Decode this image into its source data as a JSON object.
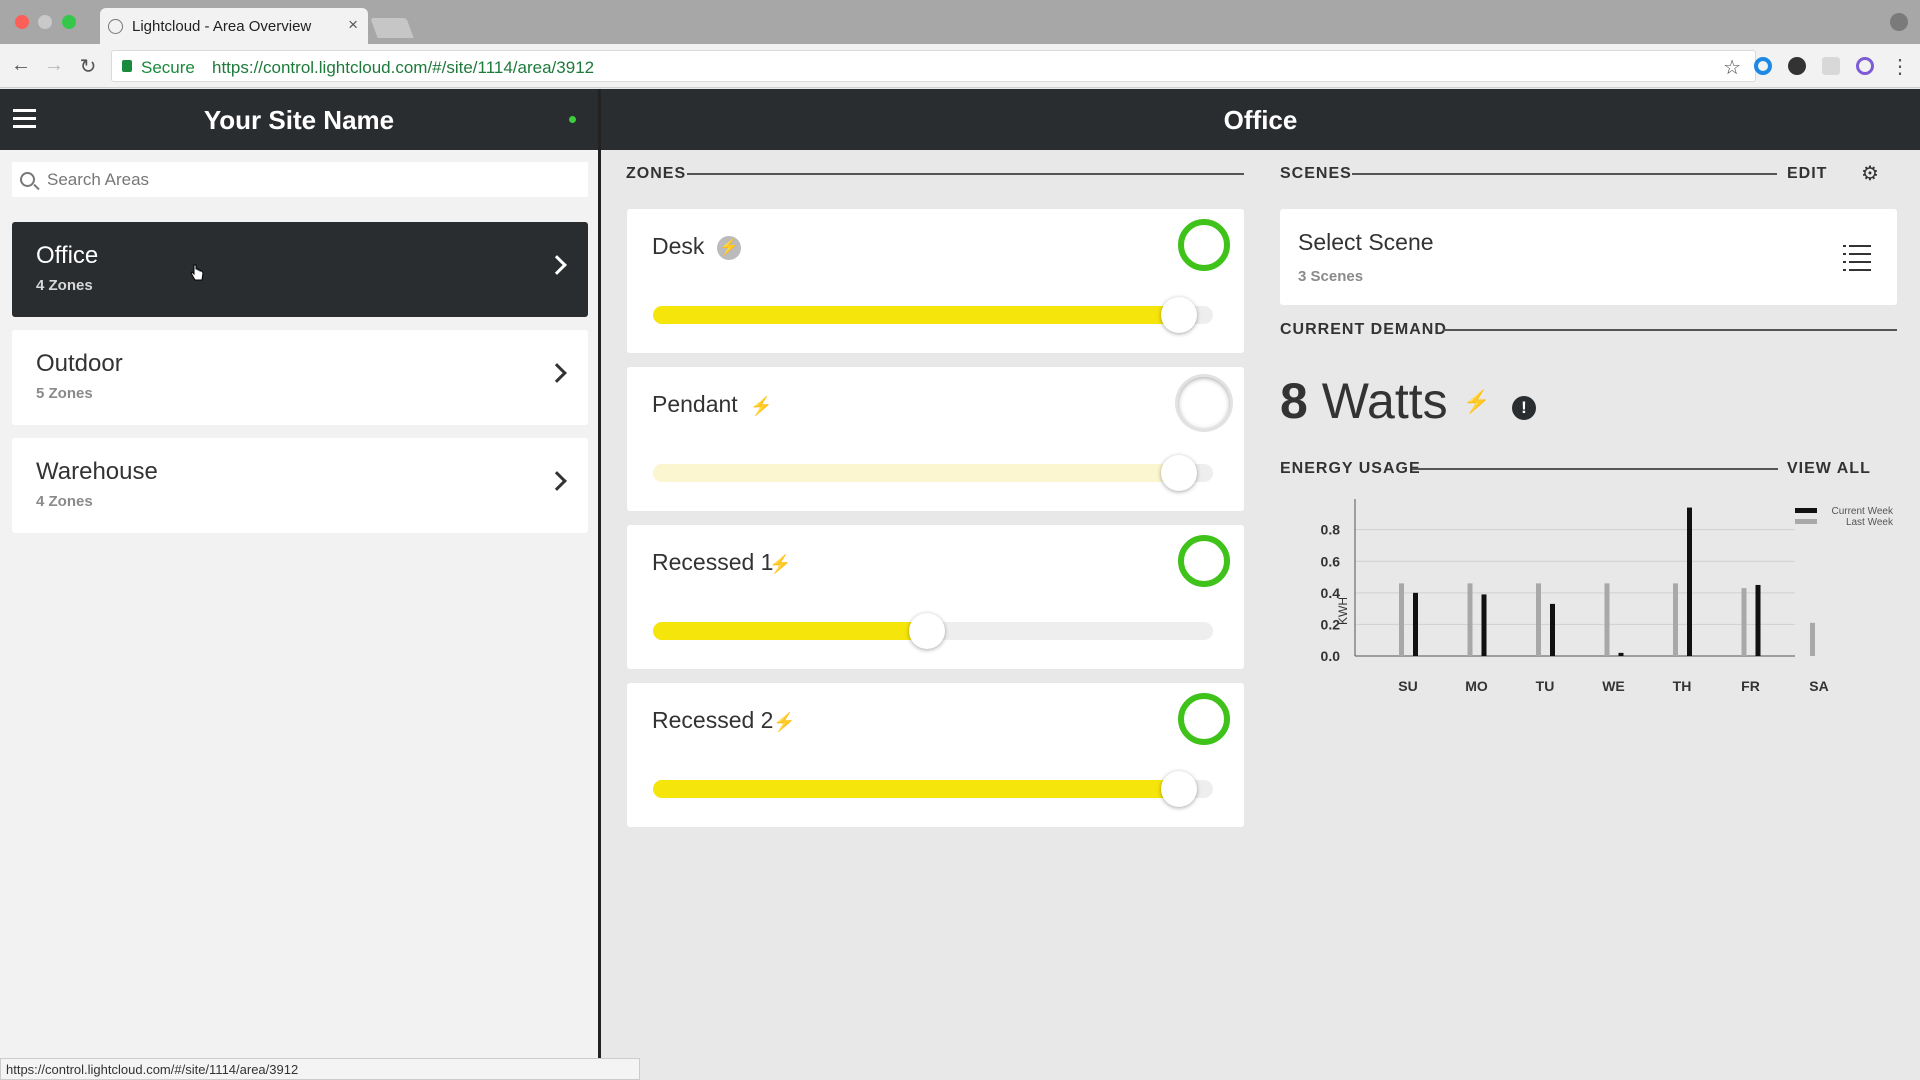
{
  "browser": {
    "tab_title": "Lightcloud - Area Overview",
    "tab_close": "×",
    "secure_label": "Secure",
    "url": "https://control.lightcloud.com/#/site/1114/area/3912",
    "status_url": "https://control.lightcloud.com/#/site/1114/area/3912"
  },
  "sidebar": {
    "site_name": "Your Site Name",
    "search_placeholder": "Search Areas",
    "areas": [
      {
        "name": "Office",
        "zones": "4 Zones",
        "active": true
      },
      {
        "name": "Outdoor",
        "zones": "5 Zones",
        "active": false
      },
      {
        "name": "Warehouse",
        "zones": "4 Zones",
        "active": false
      }
    ]
  },
  "main": {
    "title": "Office",
    "zones_label": "ZONES",
    "zones": [
      {
        "name": "Desk",
        "on": true,
        "level": 0.94
      },
      {
        "name": "Pendant",
        "on": false,
        "level": 0.94
      },
      {
        "name": "Recessed 1",
        "on": true,
        "level": 0.49
      },
      {
        "name": "Recessed 2",
        "on": true,
        "level": 0.94
      }
    ],
    "scenes_label": "SCENES",
    "edit_label": "EDIT",
    "scene_title": "Select Scene",
    "scene_count": "3 Scenes",
    "demand_label": "CURRENT DEMAND",
    "demand_number": "8",
    "demand_unit": "Watts",
    "energy_label": "ENERGY USAGE",
    "view_all_label": "VIEW ALL"
  },
  "colors": {
    "accent_green": "#3fc31a",
    "slider_yellow": "#f5e50a",
    "slider_pale": "#fbf6cf",
    "dark": "#2a2d30"
  },
  "chart_data": {
    "type": "bar",
    "categories": [
      "SU",
      "MO",
      "TU",
      "WE",
      "TH",
      "FR",
      "SA"
    ],
    "series": [
      {
        "name": "Current Week",
        "color": "#111111",
        "values": [
          0.4,
          0.39,
          0.33,
          0.02,
          0.94,
          0.45,
          null
        ]
      },
      {
        "name": "Last Week",
        "color": "#a8a8a8",
        "values": [
          0.46,
          0.46,
          0.46,
          0.46,
          0.46,
          0.43,
          0.21
        ]
      }
    ],
    "ylabel": "KWH",
    "yticks": [
      "0.0",
      "0.2",
      "0.4",
      "0.6",
      "0.8"
    ],
    "ylim": [
      0,
      0.95
    ],
    "grid": true,
    "legend": "top-right"
  }
}
